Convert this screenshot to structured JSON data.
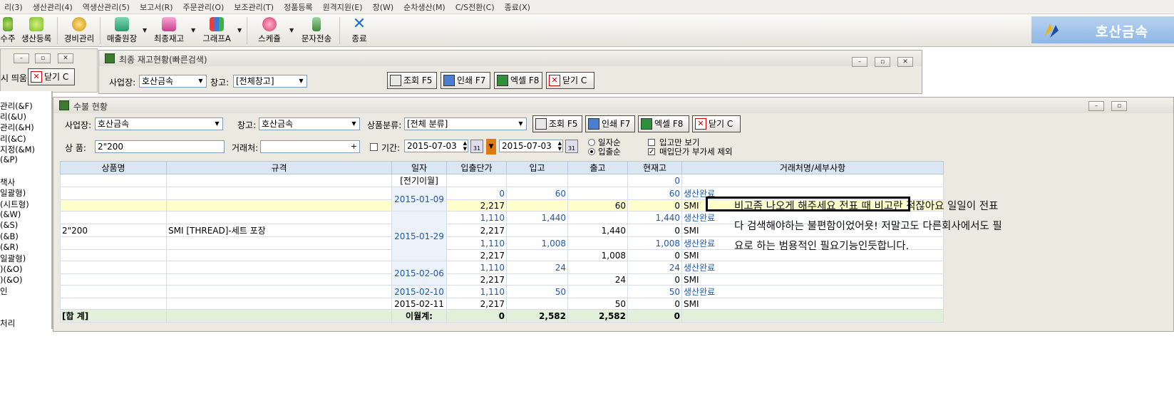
{
  "menu": [
    "리(3)",
    "생산관리(4)",
    "역생산관리(5)",
    "보고서(R)",
    "주문관리(O)",
    "보조관리(T)",
    "정품등록",
    "원격지원(E)",
    "창(W)",
    "순차생산(M)",
    "C/S전환(C)",
    "종료(X)"
  ],
  "toolbar": {
    "buttons": [
      {
        "label": "수주",
        "icon": "order-icon"
      },
      {
        "label": "생산등록",
        "icon": "production-icon"
      },
      {
        "label": "경비관리",
        "icon": "coins-icon"
      },
      {
        "label": "매출원장",
        "icon": "ledger-icon"
      },
      {
        "label": "최종재고",
        "icon": "stock-icon"
      },
      {
        "label": "그래프A",
        "icon": "chart-icon"
      },
      {
        "label": "스케쥴",
        "icon": "schedule-icon"
      },
      {
        "label": "문자전송",
        "icon": "sms-icon"
      },
      {
        "label": "종료",
        "icon": "exit-icon"
      }
    ],
    "brand": "호산금속"
  },
  "left_window": {
    "label": "시 띄움",
    "close_label": "닫기 C"
  },
  "left_nav": [
    "관리(&F)",
    "리(&U)",
    "관리(&H)",
    "리(&C)",
    "지정(&M)",
    "(&P)",
    "책사",
    "일괄형)",
    "(시트형)",
    "(&W)",
    "(&S)",
    "(&B)",
    "(&R)",
    "일괄형)",
    ")(&O)",
    ")(&O)",
    "인",
    "처리"
  ],
  "stock_window": {
    "title": "최종 재고현황(빠른검색)",
    "site_label": "사업장:",
    "site_value": "호산금속",
    "warehouse_label": "창고:",
    "warehouse_value": "[전체창고]",
    "search_button": "조회 F5",
    "print_button": "인쇄 F7",
    "excel_button": "엑셀 F8",
    "close_button": "닫기 C"
  },
  "flow_window": {
    "title": "수불 현황",
    "site_label": "사업장:",
    "site_value": "호산금속",
    "warehouse_label": "창고:",
    "warehouse_value": "호산금속",
    "category_label": "상품분류:",
    "category_value": "[전체 분류]",
    "search_button": "조회 F5",
    "print_button": "인쇄 F7",
    "excel_button": "엑셀 F8",
    "close_button": "닫기 C",
    "product_label": "상  품:",
    "product_value": "2\"200",
    "customer_label": "거래처:",
    "customer_value": "",
    "period_label": "기간:",
    "date_from": "2015-07-03",
    "date_to": "2015-07-03",
    "sort_date": "일자순",
    "sort_io": "입출순",
    "only_in_label": "입고만 보기",
    "exclude_vat_label": "매입단가 부가세 제외"
  },
  "table": {
    "headers": [
      "상품명",
      "규격",
      "일자",
      "입출단가",
      "입고",
      "출고",
      "현재고",
      "거래처명/세부사항"
    ],
    "product": "2\"200",
    "spec": "SMI [THREAD]-세트 포장",
    "carry_over_label": "[전기이월]",
    "carry_over_stock": "0",
    "rows": [
      {
        "date": "2015-01-09",
        "price": "0",
        "in": "60",
        "out": "",
        "stock": "60",
        "detail": "생산완료"
      },
      {
        "date": "",
        "price": "2,217",
        "in": "",
        "out": "60",
        "stock": "0",
        "detail": "SMI"
      },
      {
        "date": "2015-01-29",
        "price": "1,110",
        "in": "1,440",
        "out": "",
        "stock": "1,440",
        "detail": "생산완료"
      },
      {
        "date": "",
        "price": "2,217",
        "in": "",
        "out": "1,440",
        "stock": "0",
        "detail": "SMI"
      },
      {
        "date": "",
        "price": "1,110",
        "in": "1,008",
        "out": "",
        "stock": "1,008",
        "detail": "생산완료"
      },
      {
        "date": "",
        "price": "2,217",
        "in": "",
        "out": "1,008",
        "stock": "0",
        "detail": "SMI"
      },
      {
        "date": "2015-02-06",
        "price": "1,110",
        "in": "24",
        "out": "",
        "stock": "24",
        "detail": "생산완료"
      },
      {
        "date": "",
        "price": "2,217",
        "in": "",
        "out": "24",
        "stock": "0",
        "detail": "SMI"
      },
      {
        "date": "2015-02-10",
        "price": "1,110",
        "in": "50",
        "out": "",
        "stock": "50",
        "detail": "생산완료"
      },
      {
        "date": "2015-02-11",
        "price": "2,217",
        "in": "",
        "out": "50",
        "stock": "0",
        "detail": "SMI"
      }
    ],
    "total_label": "[합 계]",
    "monthly_label": "이월계:",
    "total_price": "0",
    "total_in": "2,582",
    "total_out": "2,582",
    "total_stock": "0"
  },
  "annotation": {
    "line1": "비고좀 나오게 해주세요 전표 때 비고란 적잖아요  일일이 전표",
    "line2": "다 검색해야하는 불편함이었어욧!  저말고도 다른회사에서도 필",
    "line3": "요로 하는 범용적인 필요기능인듯합니다."
  }
}
